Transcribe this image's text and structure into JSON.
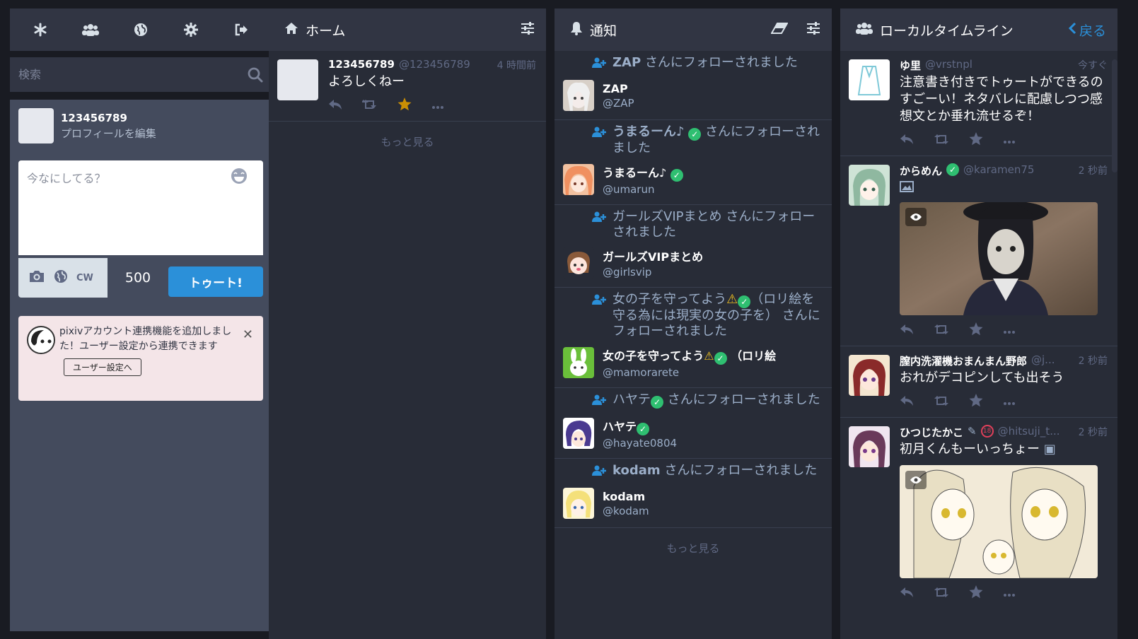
{
  "drawer": {
    "search_placeholder": "検索",
    "account_name": "123456789",
    "edit_profile": "プロフィールを編集",
    "compose_placeholder": "今なにしてる？",
    "cw_label": "CW",
    "char_count": "500",
    "toot_label": "トゥート!",
    "announcement": "pixivアカウント連携機能を追加しました！ユーザー設定から連携できます",
    "announcement_button": "ユーザー設定へ"
  },
  "home": {
    "title": "ホーム",
    "status": {
      "display_name": "123456789",
      "acct": "@123456789",
      "time": "4 時間前",
      "content": "よろしくねー"
    },
    "load_more": "もっと見る"
  },
  "notifications": {
    "title": "通知",
    "items": [
      {
        "line_name": "ZAP",
        "line_suffix": " さんにフォローされました",
        "name": "ZAP",
        "handle": "@ZAP"
      },
      {
        "line_name": "うまるーん♪",
        "line_suffix": " さんにフォローされました",
        "name": "うまるーん♪",
        "handle": "@umarun"
      },
      {
        "line_name": "ガールズVIPまとめ",
        "line_suffix": " さんにフォローされました",
        "name": "ガールズVIPまとめ",
        "handle": "@girlsvip"
      },
      {
        "line_name": "女の子を守ってよう",
        "line_suffix": "（ロリ絵を守る為には現実の女の子を） さんにフォローされました",
        "name": "女の子を守ってよう",
        "name_suffix": "（ロリ絵",
        "handle": "@mamorarete"
      },
      {
        "line_name": "ハヤテ",
        "line_suffix": " さんにフォローされました",
        "name": "ハヤテ",
        "handle": "@hayate0804"
      },
      {
        "line_name": "kodam",
        "line_suffix": " さんにフォローされました",
        "name": "kodam",
        "handle": "@kodam"
      }
    ],
    "load_more": "もっと見る"
  },
  "local": {
    "title": "ローカルタイムライン",
    "back_label": "戻る",
    "statuses": [
      {
        "display_name": "ゆ里",
        "acct": "@vrstnpl",
        "time": "今すぐ",
        "content": "注意書き付きでトゥートができるのすごーい！ネタバレに配慮しつつ感想文とか垂れ流せるぞ！"
      },
      {
        "display_name": "からめん",
        "acct": "@karamen75",
        "time": "2 秒前",
        "content": ""
      },
      {
        "display_name": "膣内洗濯機おまんまん野郎",
        "acct": "@j...",
        "time": "2 秒前",
        "content": "おれがデコピンしても出そう"
      },
      {
        "display_name": "ひつじたかこ",
        "acct": "@hitsuji_t...",
        "time": "2 秒前",
        "content": "初月くんもーいっちょー"
      }
    ]
  },
  "colors": {
    "accent": "#2b90d9",
    "favourite": "#ca8f04",
    "verified": "#2fbf71"
  }
}
